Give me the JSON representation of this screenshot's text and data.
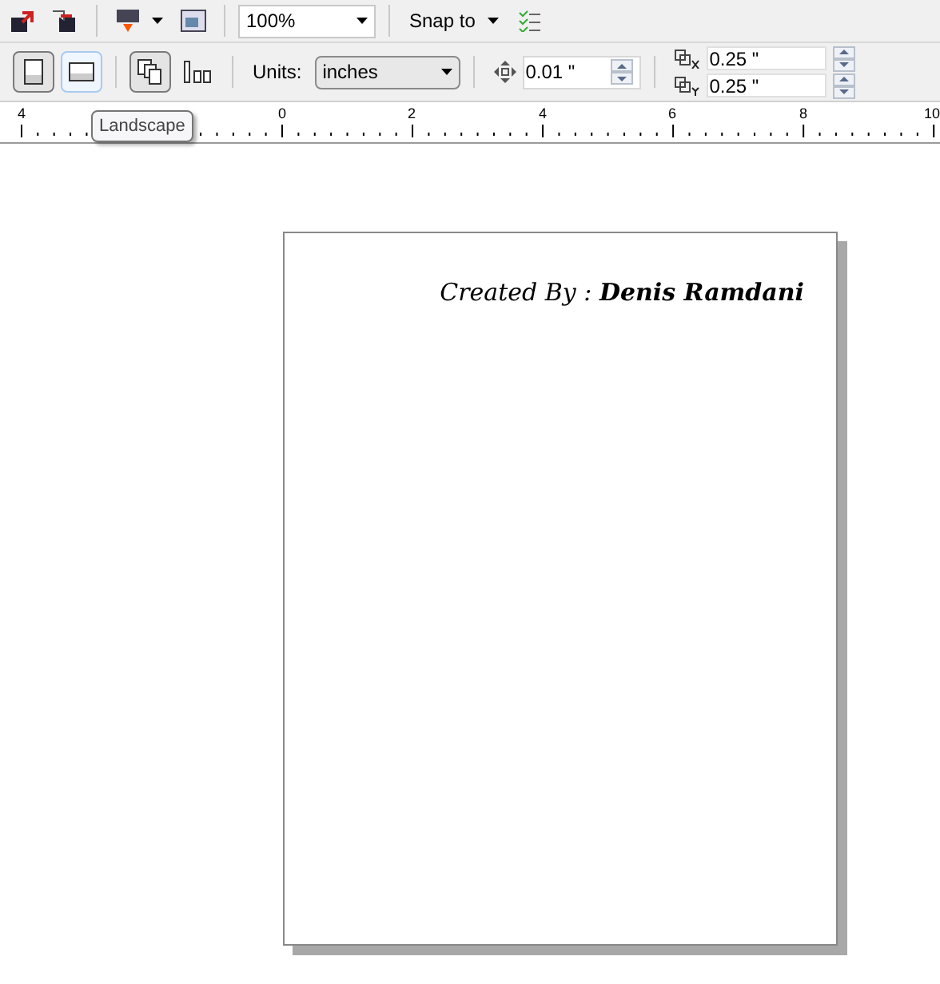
{
  "toolbar": {
    "zoom": "100%",
    "snap_label": "Snap to"
  },
  "property_bar": {
    "orientation": [
      {
        "kind": "portrait",
        "selected": true,
        "hovered": false
      },
      {
        "kind": "landscape",
        "selected": false,
        "hovered": true
      }
    ],
    "page_scope": [
      {
        "kind": "all-pages",
        "selected": true,
        "hovered": false
      },
      {
        "kind": "current-page",
        "selected": false,
        "hovered": false
      }
    ],
    "units_label": "Units:",
    "units": "inches",
    "nudge": "0.01 \"",
    "duplicate_x": "0.25 \"",
    "duplicate_y": "0.25 \""
  },
  "tooltip": "Landscape",
  "ruler": {
    "labels": [
      "4",
      "0",
      "2",
      "4",
      "6",
      "8",
      "10"
    ]
  },
  "page": {
    "text": "Created By : **Denis Ramdani**"
  }
}
